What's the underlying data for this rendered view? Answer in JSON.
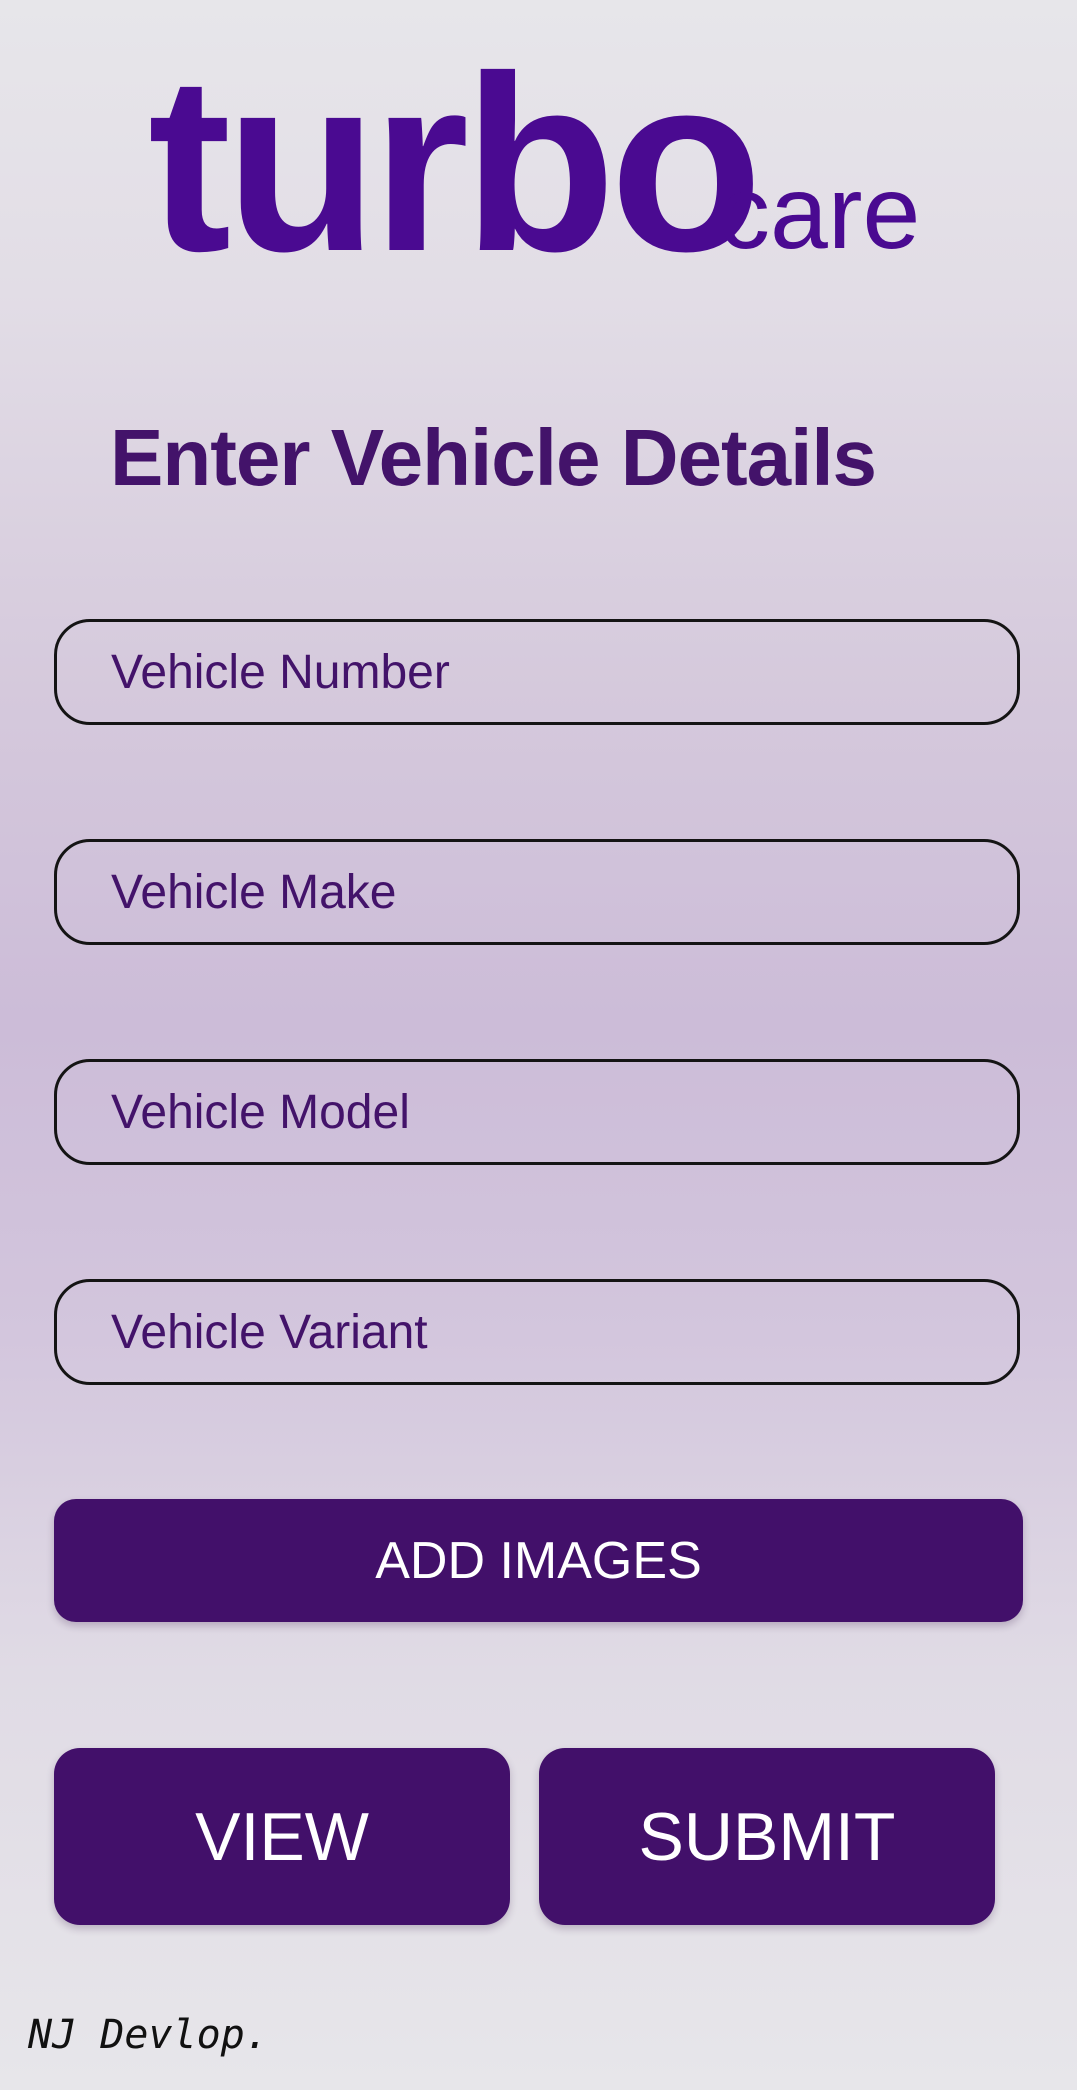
{
  "brand": {
    "logo_primary": "turbo",
    "logo_secondary": "care",
    "color": "#4a0a91"
  },
  "form": {
    "title": "Enter Vehicle Details",
    "fields": {
      "vehicle_number": {
        "placeholder": "Vehicle Number",
        "value": ""
      },
      "vehicle_make": {
        "placeholder": "Vehicle Make",
        "value": ""
      },
      "vehicle_model": {
        "placeholder": "Vehicle Model",
        "value": ""
      },
      "vehicle_variant": {
        "placeholder": "Vehicle Variant",
        "value": ""
      }
    },
    "add_images_label": "ADD IMAGES",
    "view_label": "VIEW",
    "submit_label": "SUBMIT"
  },
  "footer": {
    "credit": "NJ Devlop."
  },
  "colors": {
    "accent": "#42106a",
    "title_text": "#43136a",
    "field_border": "#141414",
    "button_text": "#ffffff"
  }
}
